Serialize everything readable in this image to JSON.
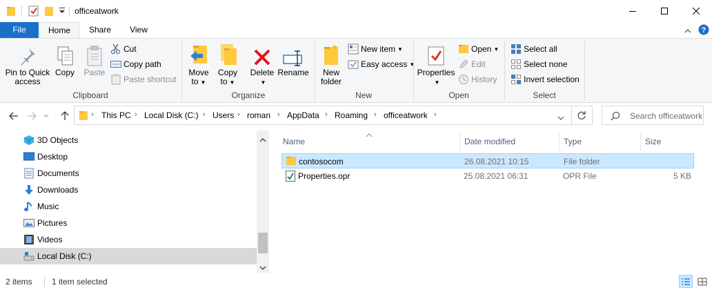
{
  "window": {
    "title": "officeatwork",
    "controls": [
      "minimize-icon",
      "maximize-icon",
      "close-icon"
    ]
  },
  "ribbon_tabs": [
    "File",
    "Home",
    "Share",
    "View"
  ],
  "ribbon": {
    "clipboard": {
      "label": "Clipboard",
      "pin": "Pin to Quick access",
      "pin_line1": "Pin to Quick",
      "pin_line2": "access",
      "copy": "Copy",
      "paste": "Paste",
      "cut": "Cut",
      "copy_path": "Copy path",
      "paste_shortcut": "Paste shortcut"
    },
    "organize": {
      "label": "Organize",
      "move_to_line1": "Move",
      "move_to_line2": "to",
      "copy_to_line1": "Copy",
      "copy_to_line2": "to",
      "delete": "Delete",
      "rename": "Rename"
    },
    "new": {
      "label": "New",
      "new_folder_line1": "New",
      "new_folder_line2": "folder",
      "new_item": "New item",
      "easy_access": "Easy access"
    },
    "open": {
      "label": "Open",
      "properties": "Properties",
      "open": "Open",
      "edit": "Edit",
      "history": "History"
    },
    "select": {
      "label": "Select",
      "select_all": "Select all",
      "select_none": "Select none",
      "invert_selection": "Invert selection"
    }
  },
  "address": {
    "breadcrumbs": [
      "This PC",
      "Local Disk (C:)",
      "Users",
      "roman",
      "AppData",
      "Roaming",
      "officeatwork"
    ],
    "search_placeholder": "Search officeatwork"
  },
  "nav_pane": {
    "items": [
      {
        "label": "3D Objects",
        "icon": "3d-objects-icon"
      },
      {
        "label": "Desktop",
        "icon": "desktop-icon"
      },
      {
        "label": "Documents",
        "icon": "documents-icon"
      },
      {
        "label": "Downloads",
        "icon": "downloads-icon"
      },
      {
        "label": "Music",
        "icon": "music-icon"
      },
      {
        "label": "Pictures",
        "icon": "pictures-icon"
      },
      {
        "label": "Videos",
        "icon": "videos-icon"
      },
      {
        "label": "Local Disk (C:)",
        "icon": "drive-icon",
        "selected": true
      }
    ]
  },
  "file_list": {
    "columns": [
      "Name",
      "Date modified",
      "Type",
      "Size"
    ],
    "rows": [
      {
        "name": "contosocom",
        "date": "26.08.2021 10:15",
        "type": "File folder",
        "size": "",
        "icon": "folder-icon",
        "selected": true
      },
      {
        "name": "Properties.opr",
        "date": "25.08.2021 06:31",
        "type": "OPR File",
        "size": "5 KB",
        "icon": "opr-file-icon",
        "selected": false
      }
    ]
  },
  "status_bar": {
    "item_count": "2 items",
    "selection": "1 item selected"
  },
  "colors": {
    "accent": "#1a6fc9",
    "selection": "#cce8ff",
    "folder": "#ffc83d"
  }
}
